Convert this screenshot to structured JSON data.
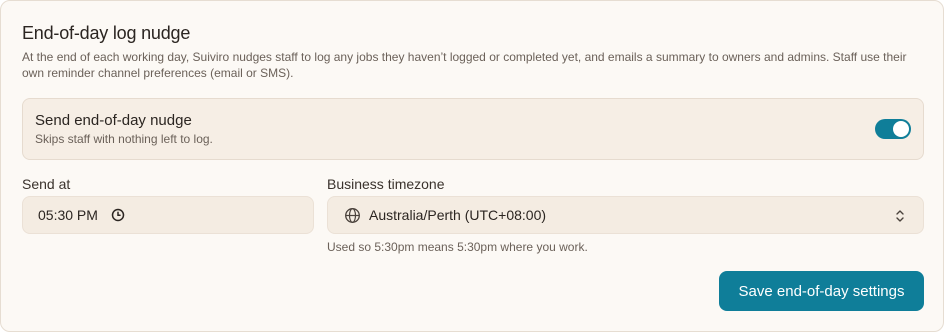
{
  "section": {
    "title": "End-of-day log nudge",
    "description": "At the end of each working day, Suiviro nudges staff to log any jobs they haven’t logged or completed yet, and emails a summary to owners and admins. Staff use their own reminder channel preferences (email or SMS)."
  },
  "nudge_toggle": {
    "label": "Send end-of-day nudge",
    "sublabel": "Skips staff with nothing left to log.",
    "enabled": true
  },
  "send_at": {
    "label": "Send at",
    "value": "05:30 PM",
    "icon": "clock-icon"
  },
  "timezone": {
    "label": "Business timezone",
    "value": "Australia/Perth (UTC+08:00)",
    "hint": "Used so 5:30pm means 5:30pm where you work.",
    "icon": "globe-icon"
  },
  "actions": {
    "save_label": "Save end-of-day settings"
  },
  "colors": {
    "accent": "#0f7e99",
    "card_bg": "#fcf9f5",
    "field_bg": "#f4ece2"
  }
}
